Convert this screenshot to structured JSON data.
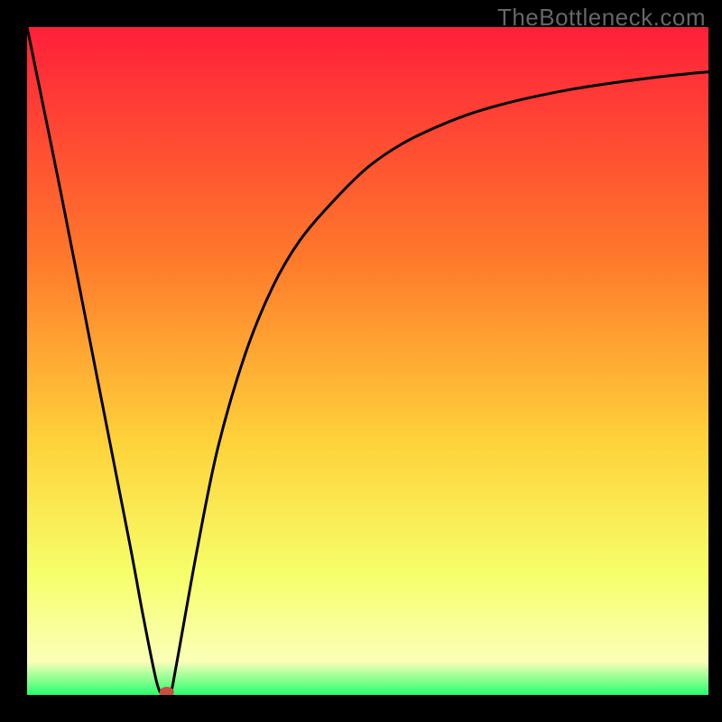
{
  "watermark": "TheBottleneck.com",
  "colors": {
    "frame": "#000000",
    "gradient_top": "#ff1f3a",
    "gradient_upper_mid": "#ff7a2b",
    "gradient_mid": "#ffd23a",
    "gradient_lower_mid": "#f6ff6a",
    "gradient_bottom_yellow": "#fbffb8",
    "gradient_bottom_green": "#2aff6e",
    "curve": "#000000",
    "marker": "#c94f45"
  },
  "chart_data": {
    "type": "line",
    "title": "",
    "xlabel": "",
    "ylabel": "",
    "xlim": [
      0,
      100
    ],
    "ylim": [
      0,
      100
    ],
    "x": [
      0,
      5,
      10,
      15,
      17,
      19,
      20,
      21,
      22,
      25,
      28,
      32,
      36,
      40,
      45,
      50,
      55,
      60,
      65,
      70,
      75,
      80,
      85,
      90,
      95,
      100
    ],
    "values": [
      100,
      75,
      49,
      23,
      12,
      2,
      0,
      0,
      5,
      22,
      37,
      51,
      61,
      68,
      74,
      79,
      82.5,
      85,
      87,
      88.5,
      89.7,
      90.7,
      91.5,
      92.2,
      92.8,
      93.3
    ],
    "marker": {
      "x": 20.5,
      "y": 0
    }
  }
}
